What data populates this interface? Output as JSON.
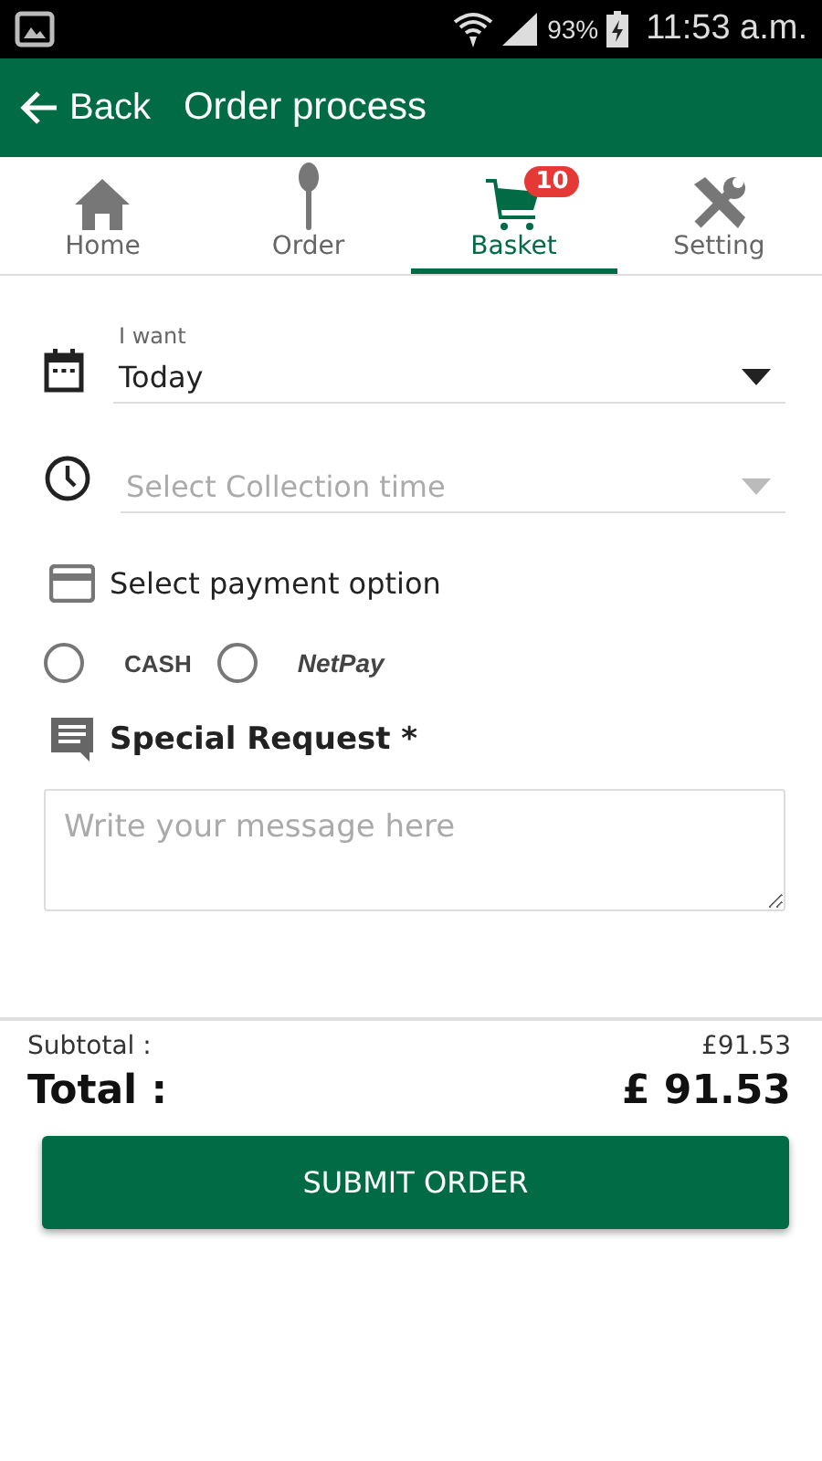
{
  "status_bar": {
    "battery": "93%",
    "time": "11:53 a.m."
  },
  "header": {
    "back": "Back",
    "title": "Order process"
  },
  "tabs": [
    {
      "kind": "home",
      "label": "Home",
      "selected": false
    },
    {
      "kind": "order",
      "label": "Order",
      "selected": false
    },
    {
      "kind": "basket",
      "label": "Basket",
      "selected": true,
      "badge": "10"
    },
    {
      "kind": "setting",
      "label": "Setting",
      "selected": false
    }
  ],
  "date_field": {
    "label": "I want",
    "value": "Today"
  },
  "time_field": {
    "placeholder": "Select Collection time"
  },
  "payment": {
    "heading": "Select payment option",
    "options": [
      {
        "kind": "cash",
        "label": "CASH",
        "selected": false
      },
      {
        "kind": "netpay",
        "label": "NetPay",
        "selected": false
      }
    ]
  },
  "special_request": {
    "heading": "Special Request *",
    "placeholder": "Write your message here"
  },
  "summary": {
    "subtotal_label": "Subtotal :",
    "subtotal": "£91.53",
    "total_label": "Total :",
    "total": "£ 91.53"
  },
  "submit": "SUBMIT ORDER"
}
